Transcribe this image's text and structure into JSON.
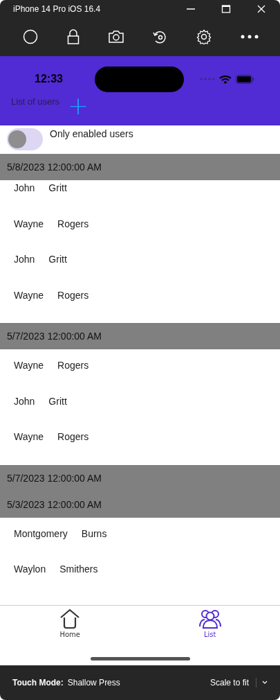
{
  "window": {
    "title": "iPhone 14 Pro iOS 16.4"
  },
  "status_bar": {
    "time": "12:33"
  },
  "header": {
    "title": "List of users",
    "add_button": "+"
  },
  "filter": {
    "label": "Only enabled users",
    "on": false
  },
  "groups": [
    {
      "date": "5/8/2023 12:00:00 AM",
      "users": [
        {
          "first": "John",
          "last": "Gritt"
        },
        {
          "first": "Wayne",
          "last": "Rogers"
        },
        {
          "first": "John",
          "last": "Gritt"
        },
        {
          "first": "Wayne",
          "last": "Rogers"
        }
      ]
    },
    {
      "date": "5/7/2023 12:00:00 AM",
      "users": [
        {
          "first": "Wayne",
          "last": "Rogers"
        },
        {
          "first": "John",
          "last": "Gritt"
        },
        {
          "first": "Wayne",
          "last": "Rogers"
        }
      ]
    },
    {
      "date": "5/7/2023 12:00:00 AM"
    },
    {
      "date": "5/3/2023 12:00:00 AM",
      "users": [
        {
          "first": "Montgomery",
          "last": "Burns"
        },
        {
          "first": "Waylon",
          "last": "Smithers"
        }
      ]
    }
  ],
  "tabs": [
    {
      "label": "Home",
      "selected": false
    },
    {
      "label": "List",
      "selected": true
    }
  ],
  "footer": {
    "touch_mode_label": "Touch Mode:",
    "touch_mode": "Shallow Press",
    "scale": "Scale to fit"
  }
}
